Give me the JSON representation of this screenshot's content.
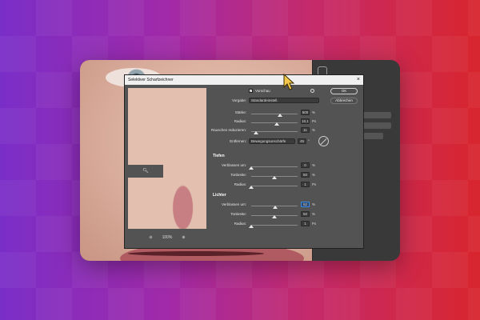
{
  "dialog": {
    "title": "Selektiver Scharfzeichner",
    "close_glyph": "×",
    "preview_check": "✓",
    "preview_label": "Vorschau",
    "ok_label": "OK",
    "cancel_label": "Abbrechen",
    "zoom_level": "100%",
    "preset_label": "Vorgabe:",
    "preset_value": "Standardeinstell.",
    "fields": [
      {
        "label": "Stärke:",
        "value": "500",
        "unit": "%",
        "pos": 0.62
      },
      {
        "label": "Radius:",
        "value": "10,1",
        "unit": "Px",
        "pos": 0.55
      },
      {
        "label": "Rauschen reduzieren:",
        "value": "11",
        "unit": "%",
        "pos": 0.1
      }
    ],
    "remove_label": "Entfernen:",
    "remove_value": "Bewegungsunschärfe",
    "angle_value": "45",
    "angle_unit": "°",
    "shadows_title": "Tiefen",
    "shadows": [
      {
        "label": "Verblassen um:",
        "value": "0",
        "unit": "%",
        "pos": 0.0
      },
      {
        "label": "Tonbreite:",
        "value": "50",
        "unit": "%",
        "pos": 0.5
      },
      {
        "label": "Radius:",
        "value": "1",
        "unit": "Px",
        "pos": 0.0
      }
    ],
    "highlights_title": "Lichter",
    "highlights": [
      {
        "label": "Verblassen um:",
        "value": "52",
        "unit": "%",
        "pos": 0.52,
        "active": true
      },
      {
        "label": "Tonbreite:",
        "value": "50",
        "unit": "%",
        "pos": 0.5
      },
      {
        "label": "Radius:",
        "value": "1",
        "unit": "Px",
        "pos": 0.0
      }
    ]
  },
  "colors": {
    "dialog_bg": "#535353",
    "accent": "#3b8ee8",
    "cursor": "#f3c84a"
  }
}
